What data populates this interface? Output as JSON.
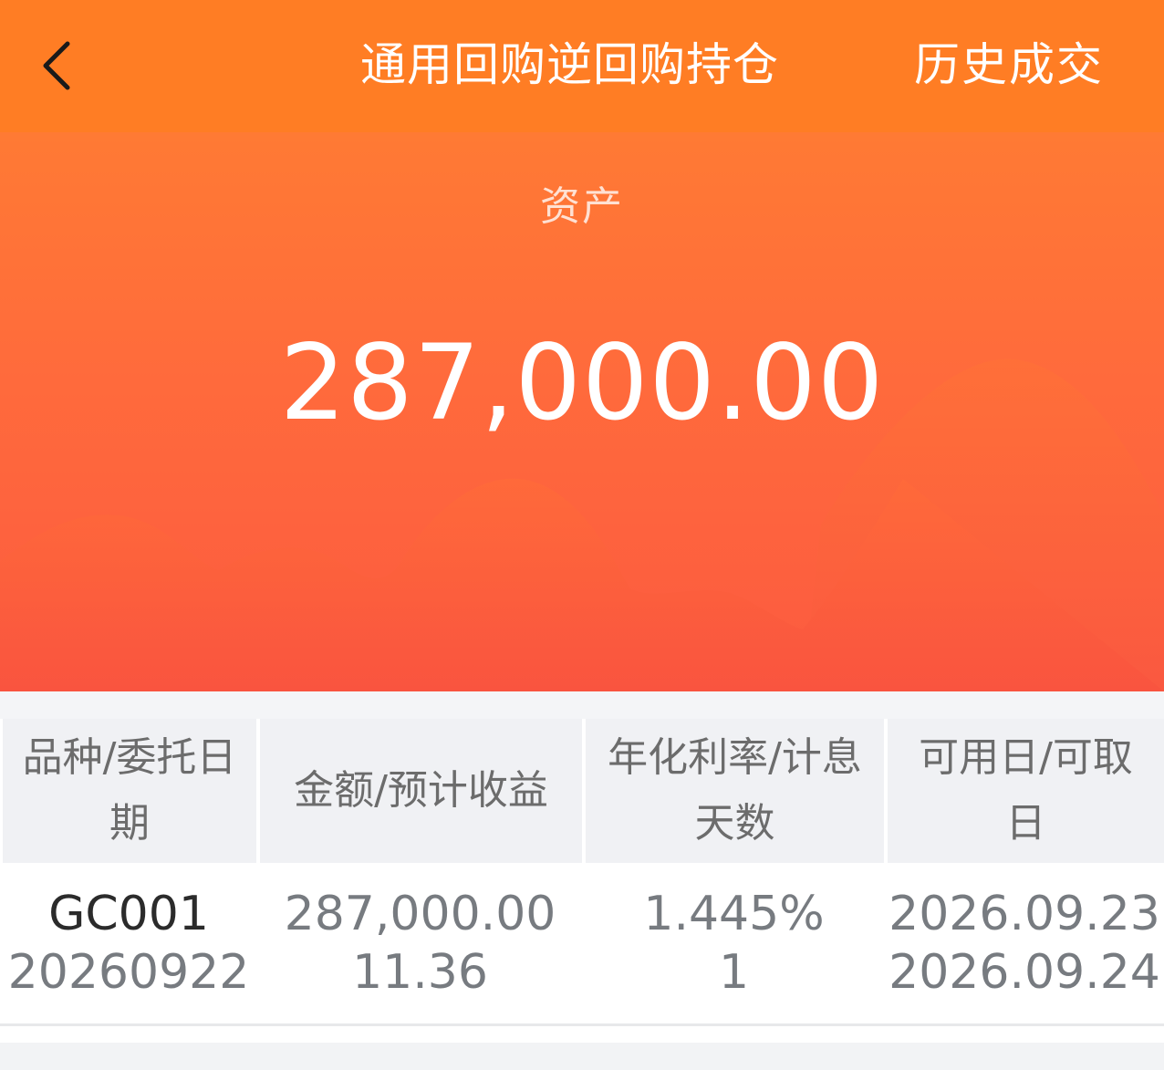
{
  "navbar": {
    "back_icon": "chevron-left-icon",
    "title": "通用回购逆回购持仓",
    "history_label": "历史成交"
  },
  "asset": {
    "label": "资产",
    "value": "287,000.00"
  },
  "table": {
    "headers": [
      "品种/委托日期",
      "金额/预计收益",
      "年化利率/计息天数",
      "可用日/可取日"
    ],
    "rows": [
      {
        "code": "GC001",
        "order_date": "20260922",
        "amount": "287,000.00",
        "expected_income": "11.36",
        "annual_rate": "1.445%",
        "days": "1",
        "available_date": "2026.09.23",
        "withdrawable_date": "2026.09.24"
      }
    ]
  },
  "colors": {
    "navbar": "#ff7d24",
    "hero_top": "#ff7a34",
    "hero_bottom": "#fc5a40",
    "header_bg": "#f0f1f4",
    "text_muted": "#777b80",
    "text_primary": "#2b2b2b"
  }
}
